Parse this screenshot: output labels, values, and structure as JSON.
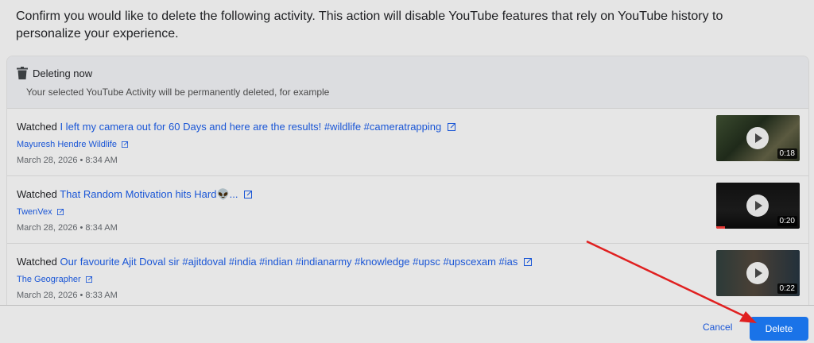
{
  "intro_text": "Confirm you would like to delete the following activity. This action will disable YouTube features that rely on YouTube history to personalize your experience.",
  "card": {
    "title": "Deleting now",
    "subtitle": "Your selected YouTube Activity will be permanently deleted, for example",
    "icon": "trash-icon"
  },
  "items": [
    {
      "prefix": "Watched",
      "title": "I left my camera out for 60 Days and here are the results! #wildlife #cameratrapping",
      "channel": "Mayuresh Hendre Wildlife",
      "date": "March 28, 2026 • 8:34 AM",
      "duration": "0:18"
    },
    {
      "prefix": "Watched",
      "title": "That Random Motivation hits Hard👽...",
      "channel": "TwenVex",
      "date": "March 28, 2026 • 8:34 AM",
      "duration": "0:20",
      "watched_fraction": 0.1
    },
    {
      "prefix": "Watched",
      "title": "Our favourite Ajit Doval sir #ajitdoval #india #indian #indianarmy #knowledge #upsc #upscexam #ias",
      "channel": "The Geographer",
      "date": "March 28, 2026 • 8:33 AM",
      "duration": "0:22"
    }
  ],
  "footer": {
    "cancel_label": "Cancel",
    "delete_label": "Delete"
  },
  "colors": {
    "link": "#1a56d6",
    "primary_button": "#1a73e8",
    "annotation_arrow": "#e02020"
  }
}
